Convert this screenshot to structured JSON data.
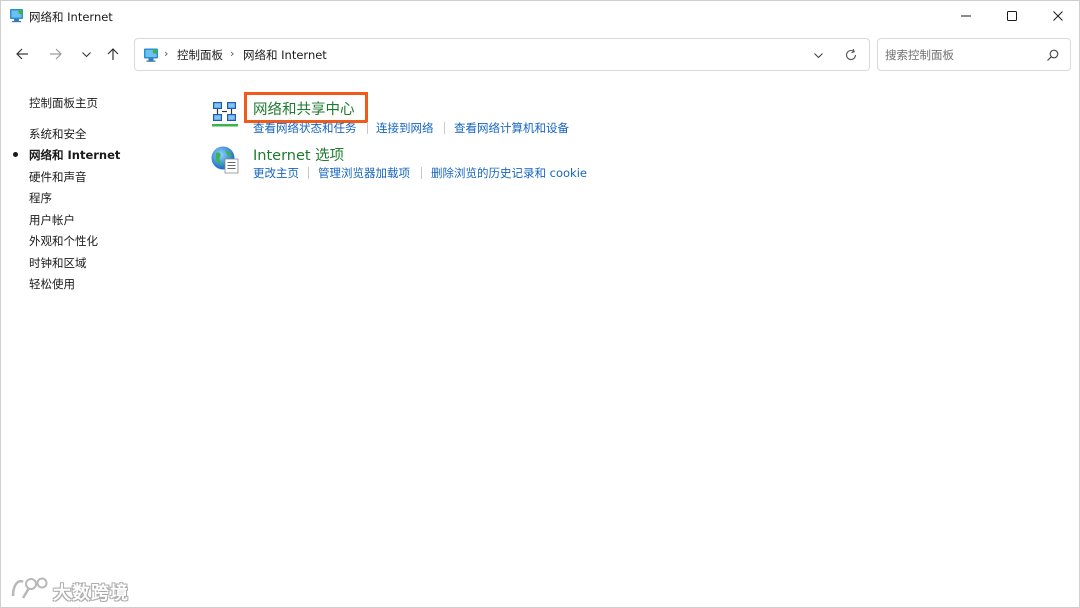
{
  "window": {
    "title": "网络和 Internet",
    "controls": [
      "minimize-icon",
      "maximize-icon",
      "close-icon"
    ]
  },
  "nav": {
    "icons": [
      "arrow-left-icon",
      "arrow-right-icon",
      "chevron-down-icon",
      "arrow-up-icon"
    ]
  },
  "address": {
    "icon": "control-panel-icon",
    "breadcrumb": [
      "控制面板",
      "网络和 Internet"
    ],
    "separator": "›",
    "dropdown_icon": "chevron-down-icon",
    "refresh_icon": "refresh-icon"
  },
  "search": {
    "placeholder": "搜索控制面板",
    "value": "",
    "icon": "search-icon"
  },
  "sidebar": {
    "items": [
      {
        "label": "控制面板主页",
        "current": false
      },
      {
        "label": "系统和安全",
        "current": false
      },
      {
        "label": "网络和 Internet",
        "current": true
      },
      {
        "label": "硬件和声音",
        "current": false
      },
      {
        "label": "程序",
        "current": false
      },
      {
        "label": "用户帐户",
        "current": false
      },
      {
        "label": "外观和个性化",
        "current": false
      },
      {
        "label": "时钟和区域",
        "current": false
      },
      {
        "label": "轻松使用",
        "current": false
      }
    ]
  },
  "categories": [
    {
      "title": "网络和共享中心",
      "icon": "network-sharing-icon",
      "highlighted": true,
      "tasks": [
        "查看网络状态和任务",
        "连接到网络",
        "查看网络计算机和设备"
      ]
    },
    {
      "title": "Internet 选项",
      "icon": "internet-options-globe-icon",
      "highlighted": false,
      "tasks": [
        "更改主页",
        "管理浏览器加载项",
        "删除浏览的历史记录和 cookie"
      ]
    }
  ],
  "colors": {
    "category_title": "#1e7a2e",
    "task_link": "#1565c0",
    "highlight_border": "#f05a1a"
  },
  "watermark": {
    "text": "大数跨境",
    "icon": "watermark-logo-icon"
  }
}
